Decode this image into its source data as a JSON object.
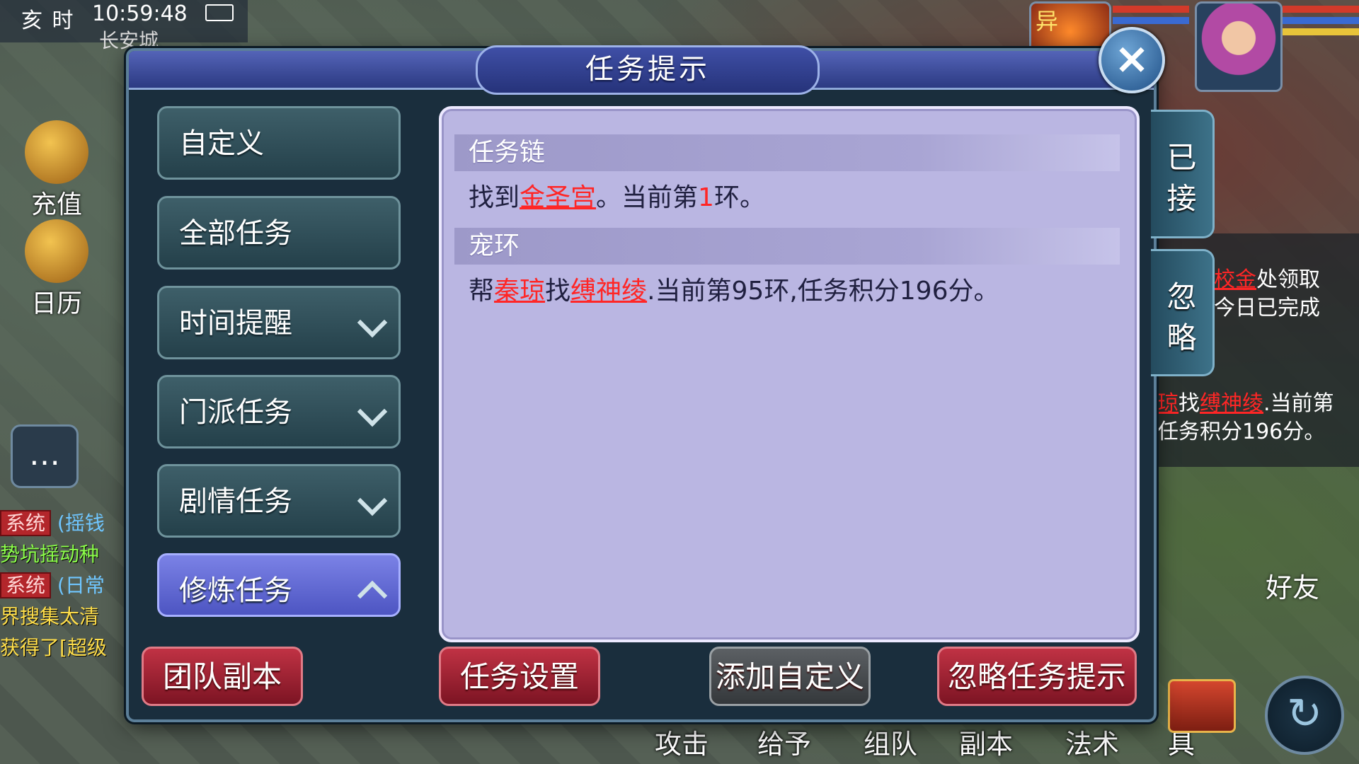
{
  "hud": {
    "time_period": "亥 时",
    "clock": "10:59:48",
    "location": "长安城",
    "left_icons": {
      "recharge": "充值",
      "calendar": "日历"
    },
    "chat": [
      {
        "badge": "系统",
        "text": "(摇钱"
      },
      {
        "text": "势坑摇动种"
      },
      {
        "badge": "系统",
        "text": "(日常"
      },
      {
        "text": "界搜集太清"
      },
      {
        "text": "获得了[超级"
      }
    ],
    "right_panel": {
      "line1_prefix": "校金",
      "line1_suffix": "处领取",
      "line2": "今日已完成",
      "line3_prefix": "琼",
      "line3_mid": "找",
      "line3_link": "缚神绫",
      "line3_suffix": ".当前第",
      "line4": "任务积分196分。"
    },
    "bottom_bar": [
      "攻击",
      "给予",
      "组队",
      "副本",
      "法术",
      "道具"
    ],
    "friend": "好友",
    "pet_badge": "异"
  },
  "dialog": {
    "title": "任务提示",
    "close_icon": "×",
    "side_tabs": {
      "accepted": "已接",
      "ignored": "忽略"
    },
    "nav": [
      {
        "label": "自定义"
      },
      {
        "label": "全部任务"
      },
      {
        "label": "时间提醒"
      },
      {
        "label": "门派任务"
      },
      {
        "label": "剧情任务"
      },
      {
        "label": "修炼任务"
      }
    ],
    "sections": [
      {
        "title": "任务链",
        "text_pre": "找到",
        "link": "金圣宫",
        "text_mid": "。当前第",
        "number": "1",
        "text_post": "环。"
      },
      {
        "title": "宠环",
        "text_pre": "帮",
        "link1": "秦琼",
        "text_mid": "找",
        "link2": "缚神绫",
        "text_post": ".当前第95环,任务积分196分。"
      }
    ],
    "buttons": {
      "team_dungeon": "团队副本",
      "task_settings": "任务设置",
      "add_custom": "添加自定义",
      "ignore_prompts": "忽略任务提示"
    }
  }
}
